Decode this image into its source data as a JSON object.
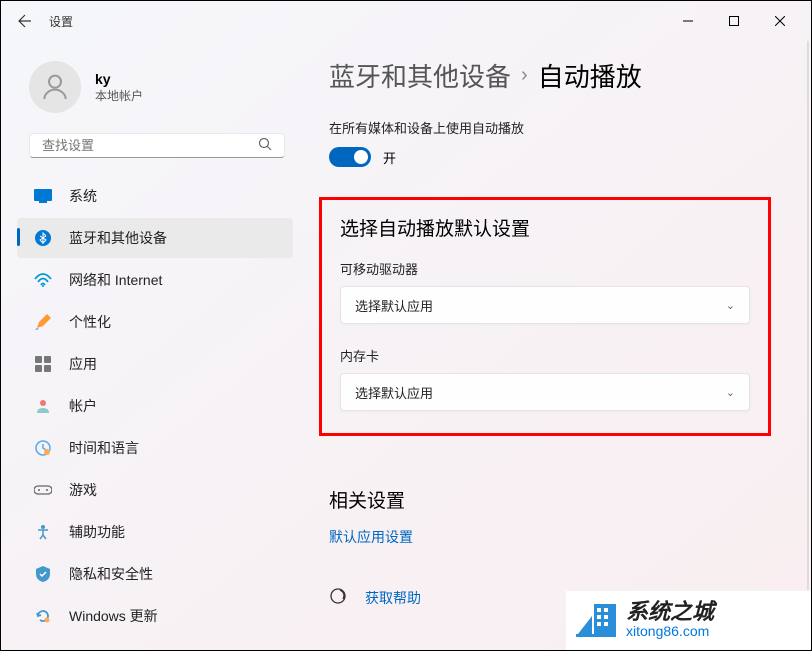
{
  "app": {
    "title": "设置"
  },
  "user": {
    "name": "ky",
    "account_type": "本地帐户"
  },
  "search": {
    "placeholder": "查找设置"
  },
  "sidebar": {
    "items": [
      {
        "label": "系统",
        "icon": "system"
      },
      {
        "label": "蓝牙和其他设备",
        "icon": "bluetooth",
        "active": true
      },
      {
        "label": "网络和 Internet",
        "icon": "network"
      },
      {
        "label": "个性化",
        "icon": "personalization"
      },
      {
        "label": "应用",
        "icon": "apps"
      },
      {
        "label": "帐户",
        "icon": "accounts"
      },
      {
        "label": "时间和语言",
        "icon": "time"
      },
      {
        "label": "游戏",
        "icon": "gaming"
      },
      {
        "label": "辅助功能",
        "icon": "accessibility"
      },
      {
        "label": "隐私和安全性",
        "icon": "privacy"
      },
      {
        "label": "Windows 更新",
        "icon": "update"
      }
    ]
  },
  "main": {
    "breadcrumb_parent": "蓝牙和其他设备",
    "breadcrumb_current": "自动播放",
    "toggle_label": "在所有媒体和设备上使用自动播放",
    "toggle_state": "开",
    "defaults_title": "选择自动播放默认设置",
    "removable_label": "可移动驱动器",
    "removable_value": "选择默认应用",
    "memory_label": "内存卡",
    "memory_value": "选择默认应用",
    "related_title": "相关设置",
    "related_link": "默认应用设置",
    "help_link": "获取帮助"
  },
  "watermark": {
    "cn": "系统之城",
    "url": "xitong86.com"
  }
}
